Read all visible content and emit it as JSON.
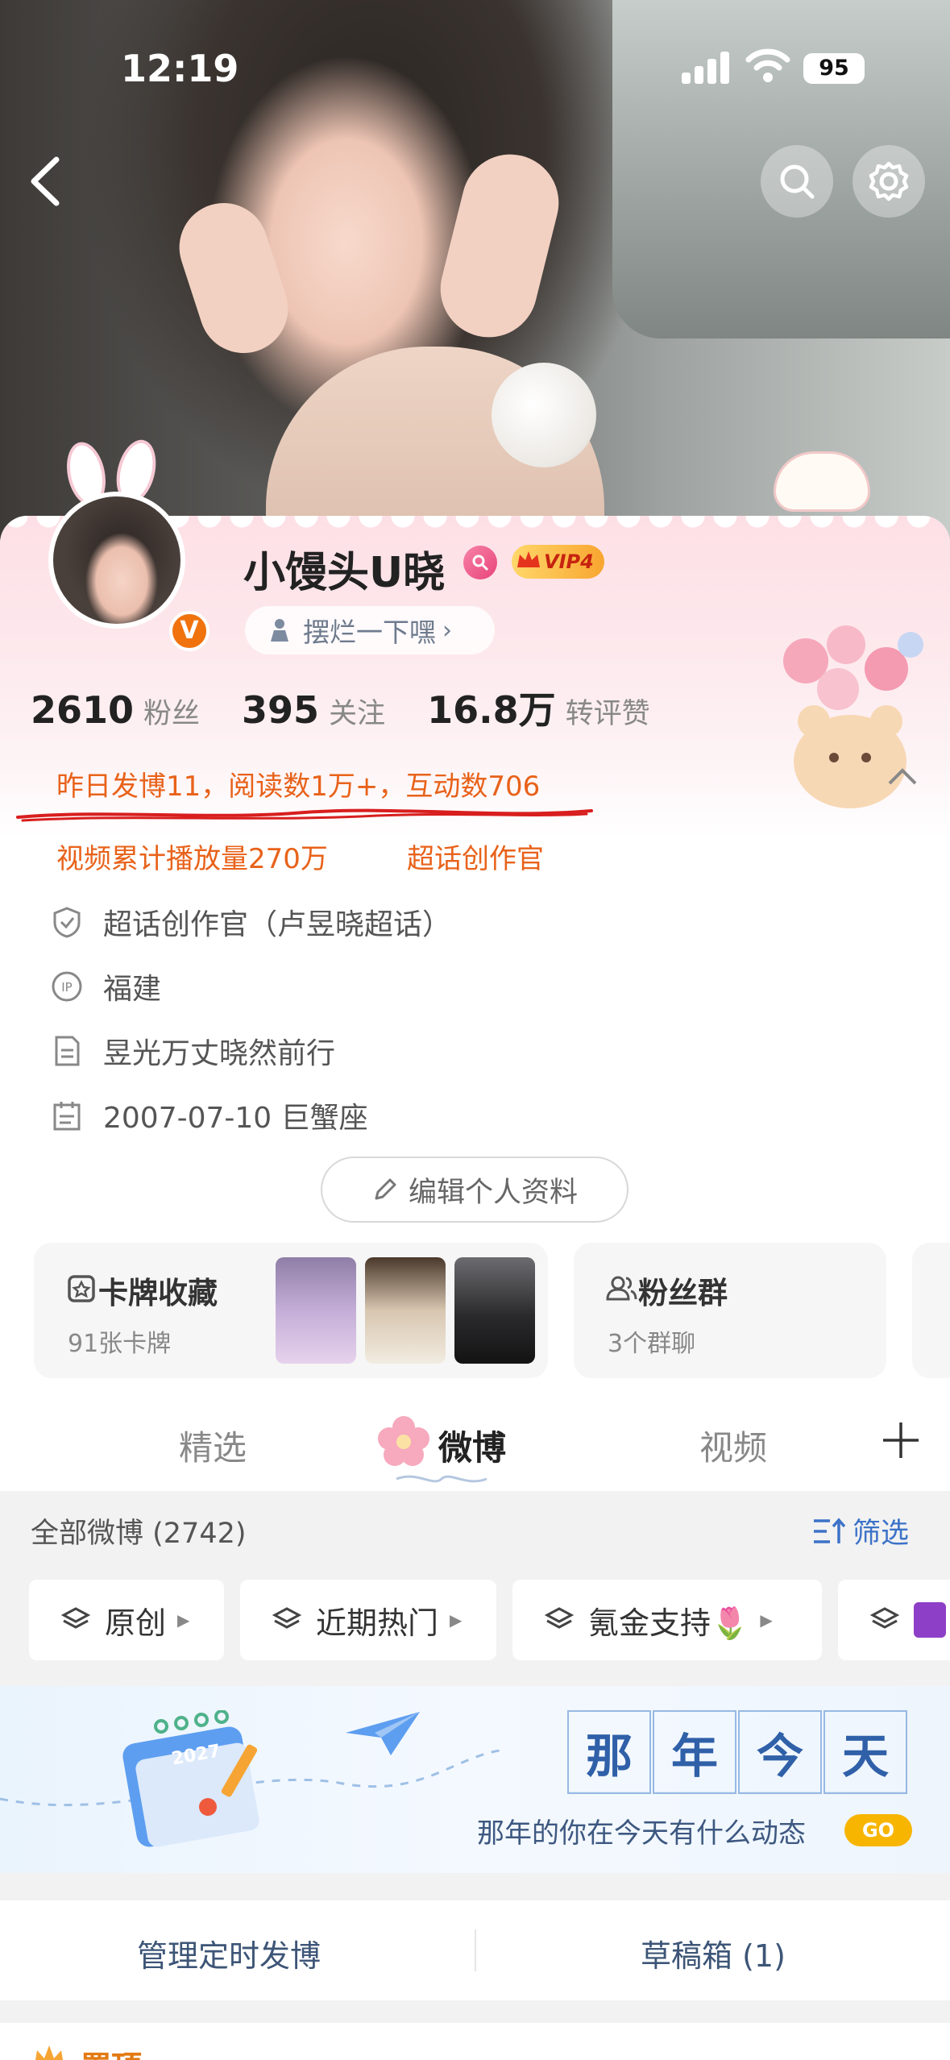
{
  "status_bar": {
    "time": "12:19",
    "battery": "95"
  },
  "profile": {
    "username": "小馒头U晓",
    "vip_label": "VIP4",
    "status_text": "摆烂一下嘿",
    "stats": [
      {
        "value": "2610",
        "label": "粉丝"
      },
      {
        "value": "395",
        "label": "关注"
      },
      {
        "value": "16.8万",
        "label": "转评赞"
      }
    ],
    "summary": "昨日发博11，阅读数1万+，互动数706",
    "highlights": [
      "视频累计播放量270万",
      "超话创作官"
    ],
    "info": [
      {
        "icon": "shield-icon",
        "text": "超话创作官（卢昱晓超话）"
      },
      {
        "icon": "ip-icon",
        "text": "福建"
      },
      {
        "icon": "document-icon",
        "text": "昱光万丈晓然前行"
      },
      {
        "icon": "calendar-icon",
        "text": "2007-07-10 巨蟹座"
      }
    ],
    "edit_button": "编辑个人资料"
  },
  "tiles": {
    "cards": {
      "title": "卡牌收藏",
      "sub": "91张卡牌"
    },
    "fans": {
      "title": "粉丝群",
      "sub": "3个群聊"
    }
  },
  "tabs": [
    "精选",
    "微博",
    "视频"
  ],
  "feed": {
    "all_label": "全部微博 (2742)",
    "filter_label": "筛选",
    "chips": [
      "原创",
      "近期热门",
      "氪金支持🌷"
    ],
    "banner": {
      "chars": [
        "那",
        "年",
        "今",
        "天"
      ],
      "calendar_year": "2027",
      "subtitle": "那年的你在今天有什么动态",
      "go": "GO"
    },
    "bottom": {
      "left": "管理定时发博",
      "right": "草稿箱 (1)"
    },
    "pinned_label": "置顶"
  },
  "colors": {
    "accent_orange": "#e8621a",
    "link_blue": "#3c72c8",
    "vip_gold": "#f8a630"
  }
}
